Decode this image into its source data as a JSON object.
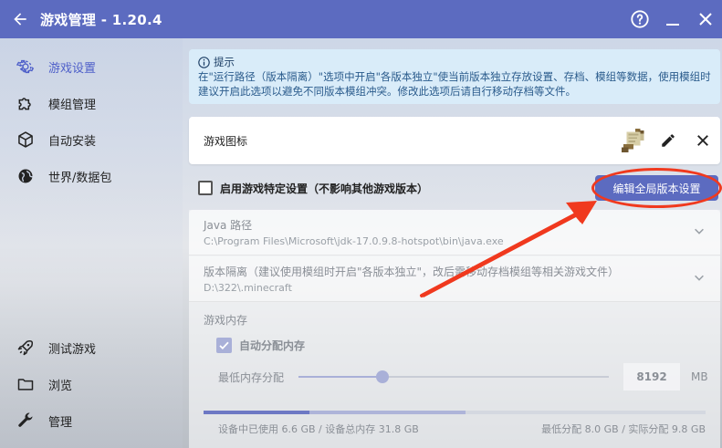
{
  "window": {
    "title": "游戏管理 - 1.20.4",
    "icons": {
      "back": "arrow-left-icon",
      "help": "help-circle-icon",
      "minimize": "minimize-icon",
      "close": "close-icon"
    }
  },
  "sidebar": {
    "top_items": [
      {
        "label": "游戏设置",
        "icon": "gear-icon",
        "active": true
      },
      {
        "label": "模组管理",
        "icon": "puzzle-icon",
        "active": false
      },
      {
        "label": "自动安装",
        "icon": "cube-icon",
        "active": false
      },
      {
        "label": "世界/数据包",
        "icon": "globe-icon",
        "active": false
      }
    ],
    "bottom_items": [
      {
        "label": "测试游戏",
        "icon": "rocket-icon"
      },
      {
        "label": "浏览",
        "icon": "folder-icon"
      },
      {
        "label": "管理",
        "icon": "wrench-icon"
      }
    ]
  },
  "hint": {
    "title": "提示",
    "text": "在\"运行路径（版本隔离）\"选项中开启\"各版本独立\"使当前版本独立存放设置、存档、模组等数据，使用模组时建议开启此选项以避免不同版本模组冲突。修改此选项后请自行移动存档等文件。"
  },
  "game_icon": {
    "label": "游戏图标",
    "icon": "scroll-icon"
  },
  "specific_settings": {
    "label": "启用游戏特定设置（不影响其他游戏版本）",
    "checked": false
  },
  "global_button": {
    "label": "编辑全局版本设置"
  },
  "java": {
    "title": "Java 路径",
    "value": "C:\\Program Files\\Microsoft\\jdk-17.0.9.8-hotspot\\bin\\java.exe"
  },
  "isolation": {
    "title": "版本隔离（建议使用模组时开启\"各版本独立\"，改后需移动存档模组等相关游戏文件）",
    "value": "D:\\322\\.minecraft"
  },
  "memory": {
    "title": "游戏内存",
    "auto_label": "自动分配内存",
    "auto_checked": true,
    "min_label": "最低内存分配",
    "min_value": "8192",
    "unit": "MB",
    "slider_fraction": 0.27,
    "used_fraction": 0.21,
    "alloc_fraction": 0.31,
    "usage_left": "设备中已使用 6.6 GB / 设备总内存 31.8 GB",
    "usage_right": "最低分配 8.0 GB / 实际分配 9.8 GB"
  },
  "colors": {
    "accent": "#5c6bc0",
    "annotation": "#f0391e",
    "hint_bg": "#d9ecf9"
  }
}
